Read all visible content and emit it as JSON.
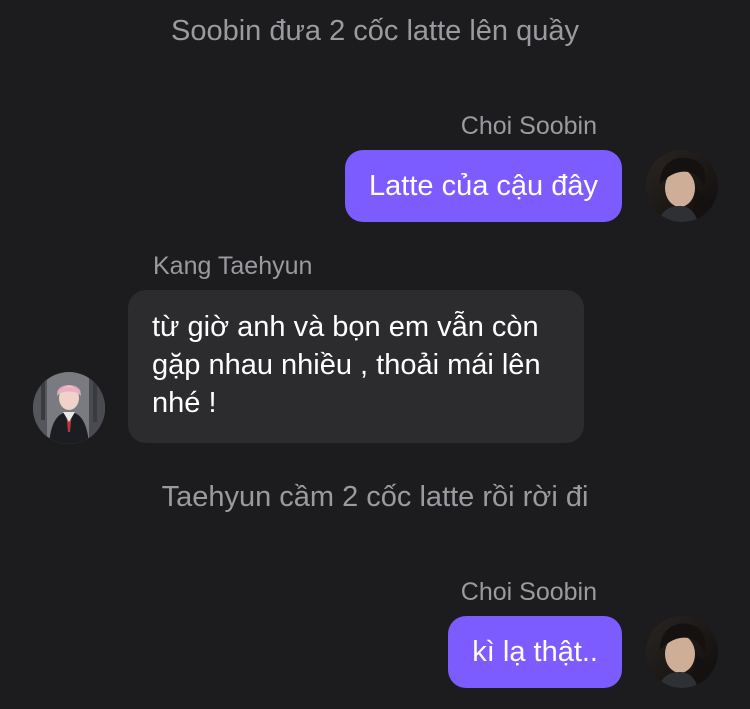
{
  "chat": {
    "narration_1": "Soobin đưa 2 cốc latte lên quầy",
    "narration_2": "Taehyun cầm 2 cốc latte rồi rời đi",
    "messages": [
      {
        "sender": "Choi Soobin",
        "text": "Latte của cậu đây",
        "direction": "outgoing",
        "avatar_icon": "soobin-avatar"
      },
      {
        "sender": "Kang Taehyun",
        "text": "từ giờ anh và bọn em vẫn còn gặp nhau nhiều , thoải mái lên nhé !",
        "direction": "incoming",
        "avatar_icon": "taehyun-avatar"
      },
      {
        "sender": "Choi Soobin",
        "text": "kì lạ thật..",
        "direction": "outgoing",
        "avatar_icon": "soobin-avatar"
      }
    ]
  },
  "colors": {
    "background": "#1c1c1e",
    "outgoing_bubble": "#7c5cff",
    "incoming_bubble": "#2c2c2e",
    "meta_text": "#9a9a9f",
    "message_text": "#ffffff"
  }
}
